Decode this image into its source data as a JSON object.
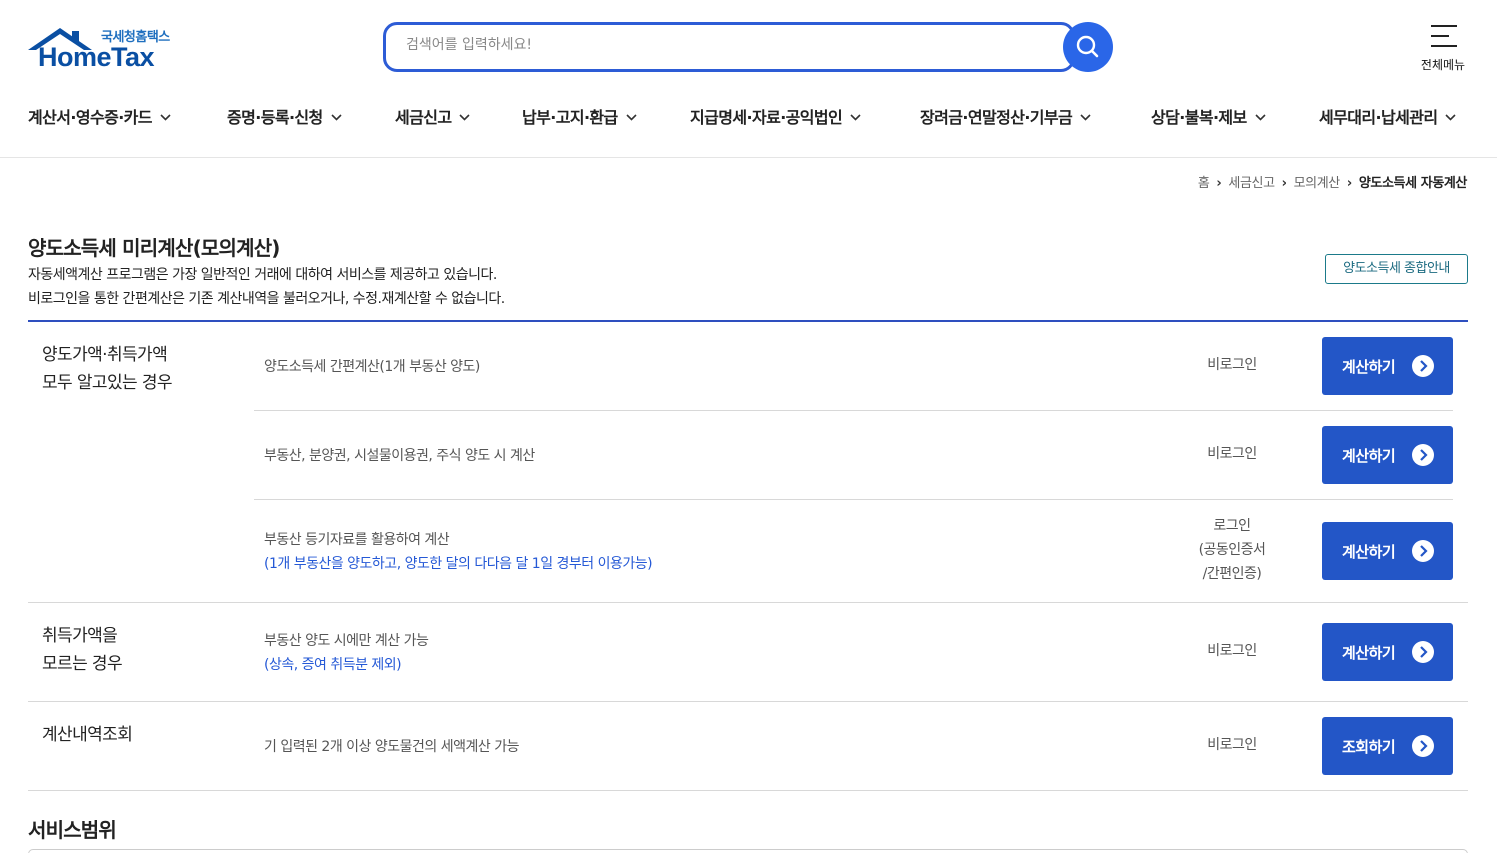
{
  "logo": {
    "small_text": "국세청홈택스",
    "big_text": "HomeTax"
  },
  "search": {
    "placeholder": "검색어를 입력하세요!"
  },
  "menu": {
    "label": "전체메뉴"
  },
  "nav": [
    "계산서·영수증·카드",
    "증명·등록·신청",
    "세금신고",
    "납부·고지·환급",
    "지급명세·자료·공익법인",
    "장려금·연말정산·기부금",
    "상담·불복·제보",
    "세무대리·납세관리"
  ],
  "breadcrumb": {
    "home": "홈",
    "level1": "세금신고",
    "level2": "모의계산",
    "current": "양도소득세 자동계산"
  },
  "page": {
    "title": "양도소득세 미리계산(모의계산)",
    "desc1": "자동세액계산 프로그램은 가장 일반적인 거래에 대하여 서비스를 제공하고 있습니다.",
    "desc2": "비로그인을 통한 간편계산은 기존 계산내역을 불러오거나, 수정.재계산할 수 없습니다.",
    "guide_button": "양도소득세 종합안내"
  },
  "groups": {
    "g1": {
      "line1": "양도가액·취득가액",
      "line2": "모두 알고있는 경우"
    },
    "g2": {
      "line1": "취득가액을",
      "line2": "모르는 경우"
    },
    "g3": {
      "line1": "계산내역조회"
    }
  },
  "rows": {
    "r1": {
      "text": "양도소득세 간편계산(1개 부동산 양도)",
      "login": "비로그인",
      "button": "계산하기"
    },
    "r2": {
      "text": "부동산, 분양권, 시설물이용권, 주식 양도 시 계산",
      "login": "비로그인",
      "button": "계산하기"
    },
    "r3": {
      "text": "부동산 등기자료를 활용하여 계산",
      "note": "(1개 부동산을 양도하고, 양도한 달의 다다음 달 1일 경부터 이용가능)",
      "login1": "로그인",
      "login2": "(공동인증서",
      "login3": "/간편인증)",
      "button": "계산하기"
    },
    "r4": {
      "text": "부동산 양도 시에만 계산 가능",
      "note": "(상속, 증여 취득분 제외)",
      "login": "비로그인",
      "button": "계산하기"
    },
    "r5": {
      "text": "기 입력된 2개 이상 양도물건의 세액계산 가능",
      "login": "비로그인",
      "button": "조회하기"
    }
  },
  "section": {
    "title": "서비스범위"
  },
  "colors": {
    "primary_button": "#2356c7",
    "accent": "#2d5cd6",
    "note_text": "#2559d6"
  }
}
